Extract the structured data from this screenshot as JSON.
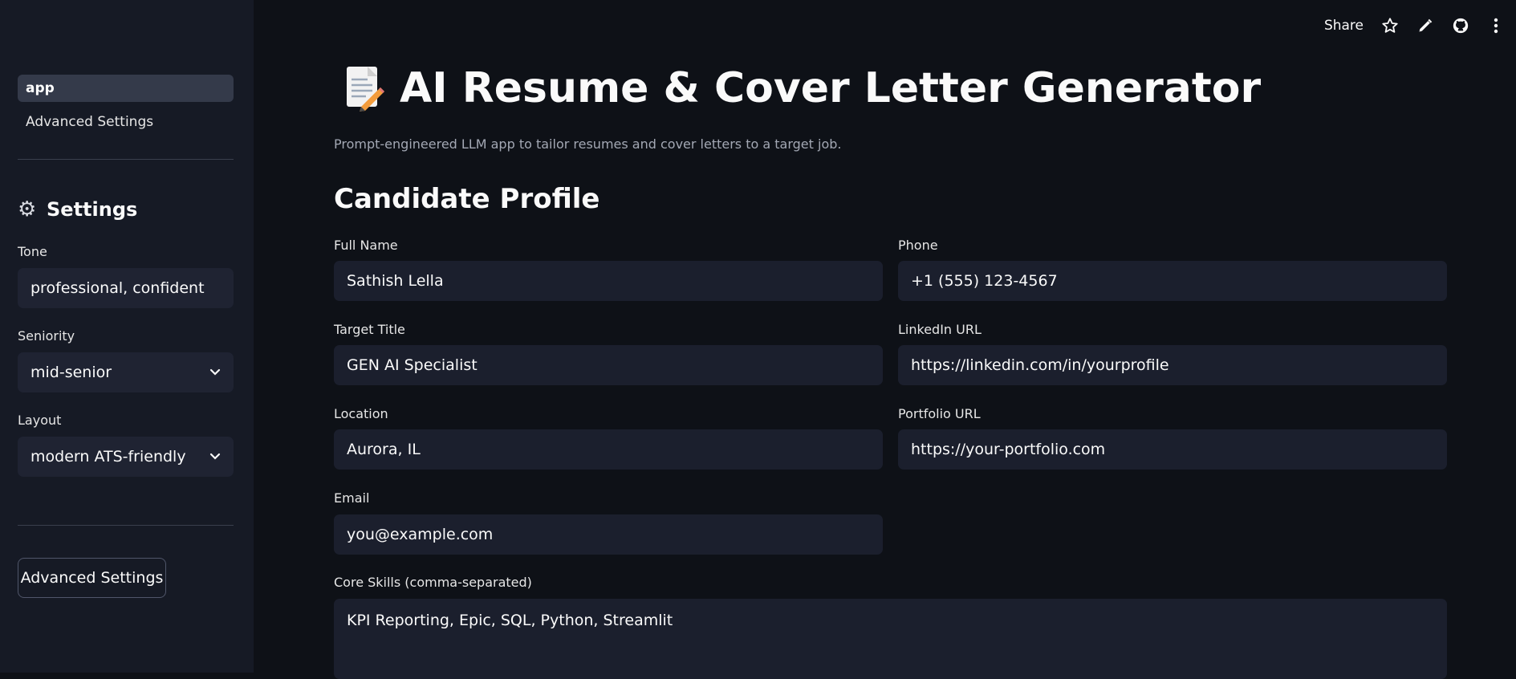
{
  "sidebar": {
    "nav": [
      {
        "label": "app",
        "active": true
      },
      {
        "label": "Advanced Settings",
        "active": false
      }
    ],
    "heading": "Settings",
    "heading_icon": "gear-icon",
    "tone": {
      "label": "Tone",
      "value": "professional, confident"
    },
    "seniority": {
      "label": "Seniority",
      "value": "mid-senior"
    },
    "layout": {
      "label": "Layout",
      "value": "modern ATS-friendly"
    },
    "button_label": "Advanced Settings"
  },
  "topbar": {
    "share_label": "Share",
    "icons": [
      "star-icon",
      "edit-icon",
      "github-icon",
      "more-icon"
    ]
  },
  "main": {
    "title": "AI Resume & Cover Letter Generator",
    "subtitle": "Prompt-engineered LLM app to tailor resumes and cover letters to a target job.",
    "section_title": "Candidate Profile",
    "fields": {
      "full_name": {
        "label": "Full Name",
        "value": "Sathish Lella"
      },
      "phone": {
        "label": "Phone",
        "value": "+1 (555) 123-4567"
      },
      "target_title": {
        "label": "Target Title",
        "value": "GEN AI Specialist"
      },
      "linkedin": {
        "label": "LinkedIn URL",
        "value": "https://linkedin.com/in/yourprofile"
      },
      "location": {
        "label": "Location",
        "value": "Aurora, IL"
      },
      "portfolio": {
        "label": "Portfolio URL",
        "value": "https://your-portfolio.com"
      },
      "email": {
        "label": "Email",
        "value": "you@example.com"
      },
      "core_skills": {
        "label": "Core Skills (comma-separated)",
        "value": "KPI Reporting, Epic, SQL, Python, Streamlit"
      }
    }
  },
  "colors": {
    "background": "#0e1117",
    "sidebar": "#161a25",
    "input": "#1b1f2d",
    "muted_text": "#a3a8b4"
  }
}
